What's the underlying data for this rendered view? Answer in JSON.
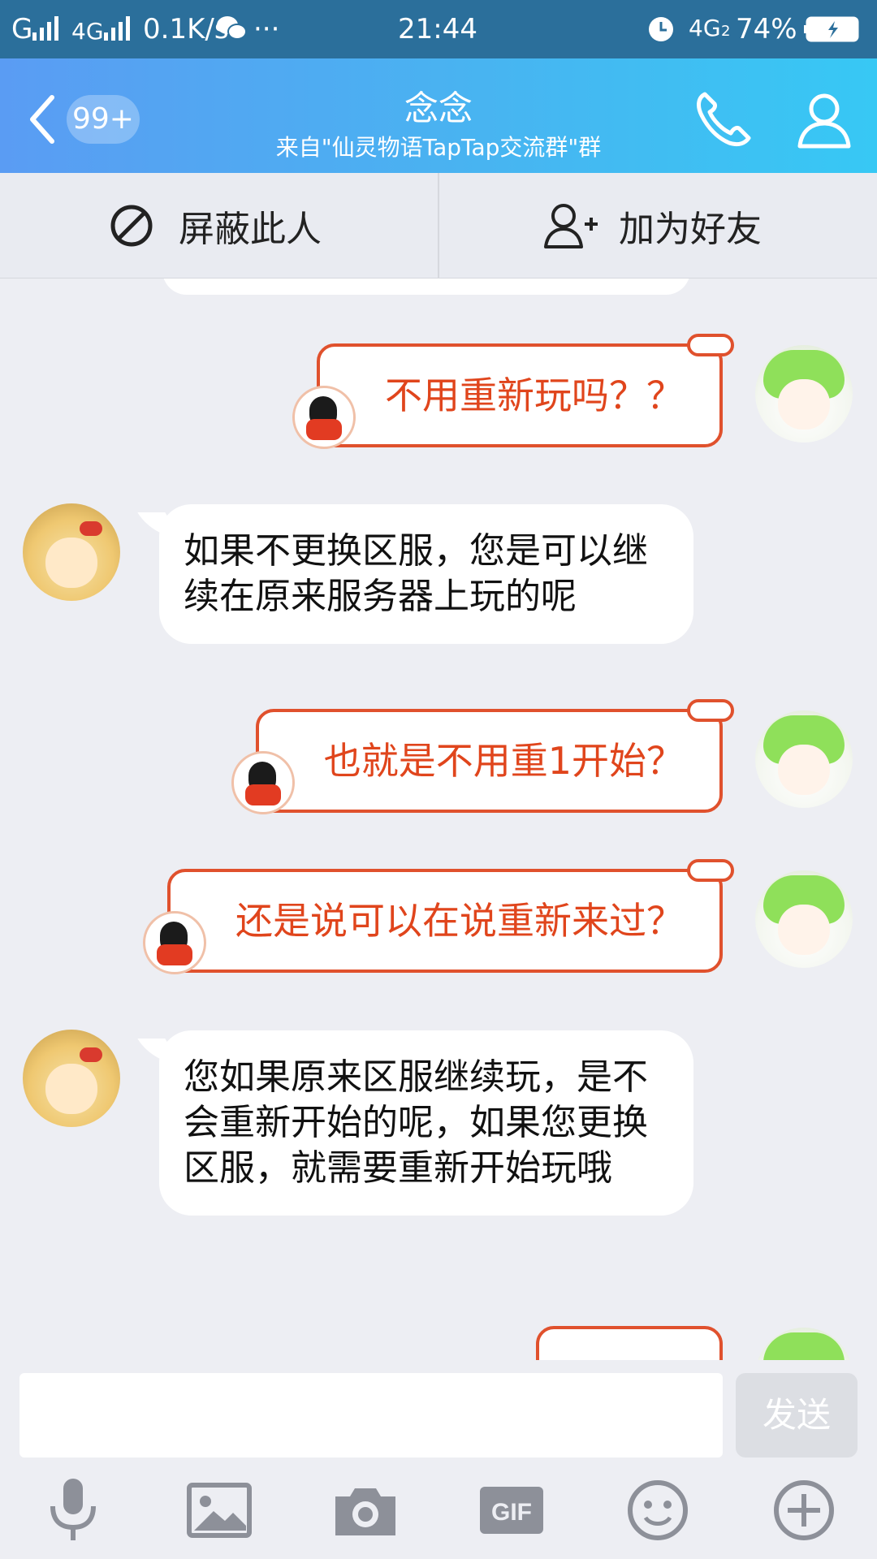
{
  "status": {
    "carrier": "G",
    "network2": "4G",
    "speed": "0.1K/s",
    "more": "···",
    "time": "21:44",
    "net_right": "4G",
    "net_sub": "2",
    "battery": "74%"
  },
  "header": {
    "badge": "99+",
    "title": "念念",
    "subtitle": "来自\"仙灵物语TapTap交流群\"群"
  },
  "actions": {
    "block": "屏蔽此人",
    "add_friend": "加为好友"
  },
  "messages": [
    {
      "from": "me",
      "text": "不用重新玩吗？？"
    },
    {
      "from": "them",
      "text": "如果不更换区服，您是可以继续在原来服务器上玩的呢"
    },
    {
      "from": "me",
      "text": "也就是不用重1开始？"
    },
    {
      "from": "me",
      "text": "还是说可以在说重新来过？"
    },
    {
      "from": "them",
      "text": "您如果原来区服继续玩，是不会重新开始的呢，如果您更换区服，就需要重新开始玩哦"
    }
  ],
  "input": {
    "send": "发送"
  },
  "toolbar_icons": [
    "microphone-icon",
    "image-icon",
    "camera-icon",
    "gif-icon",
    "emoji-icon",
    "plus-icon"
  ],
  "colors": {
    "header_start": "#5a9cf3",
    "header_end": "#37c8f4",
    "bubble_border": "#e0512d",
    "bubble_text": "#e0451c"
  }
}
